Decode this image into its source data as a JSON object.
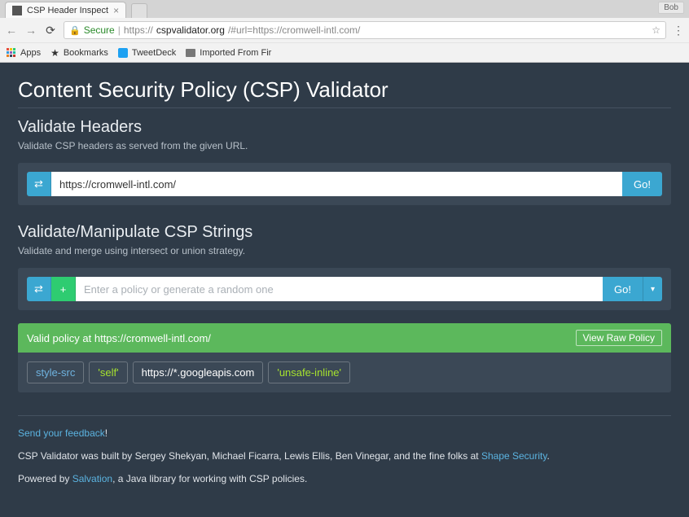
{
  "browser": {
    "tab_title": "CSP Header Inspect",
    "user_badge": "Bob",
    "secure_label": "Secure",
    "url_scheme": "https://",
    "url_host": "cspvalidator.org",
    "url_path": "/#url=https://cromwell-intl.com/",
    "bookmarks": {
      "apps": "Apps",
      "bookmarks": "Bookmarks",
      "tweetdeck": "TweetDeck",
      "imported": "Imported From Fir"
    }
  },
  "page": {
    "title": "Content Security Policy (CSP) Validator",
    "validate_headers": {
      "heading": "Validate Headers",
      "subtext": "Validate CSP headers as served from the given URL.",
      "input_value": "https://cromwell-intl.com/",
      "go_label": "Go!"
    },
    "validate_strings": {
      "heading": "Validate/Manipulate CSP Strings",
      "subtext": "Validate and merge using intersect or union strategy.",
      "placeholder": "Enter a policy or generate a random one",
      "go_label": "Go!"
    },
    "result": {
      "status_text": "Valid policy at https://cromwell-intl.com/",
      "view_raw_label": "View Raw Policy",
      "tokens": {
        "directive": "style-src",
        "kw_self": "'self'",
        "val_host": "https://*.googleapis.com",
        "kw_unsafe": "'unsafe-inline'"
      }
    },
    "footer": {
      "feedback_link": "Send your feedback",
      "feedback_excl": "!",
      "built_by_pre": "CSP Validator was built by Sergey Shekyan, Michael Ficarra, Lewis Ellis, Ben Vinegar, and the fine folks at ",
      "shape_link": "Shape Security",
      "built_by_post": ".",
      "powered_pre": "Powered by ",
      "salvation_link": "Salvation",
      "powered_post": ", a Java library for working with CSP policies."
    }
  }
}
